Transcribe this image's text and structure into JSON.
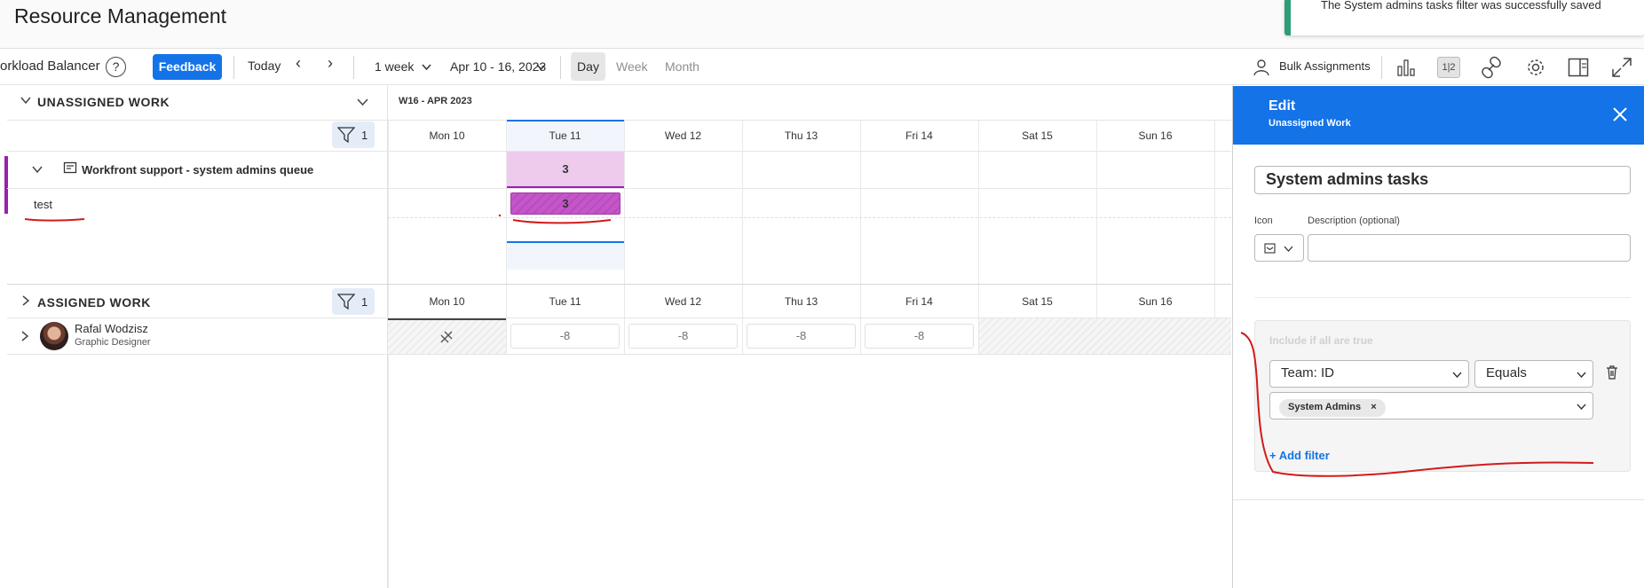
{
  "header": {
    "title": "Resource Management"
  },
  "toast": {
    "message": "The System admins tasks filter was successfully saved"
  },
  "toolbar": {
    "app_name": "orkload Balancer",
    "help_icon": "?",
    "feedback_label": "Feedback",
    "today_label": "Today",
    "range_label": "1 week",
    "date_range": "Apr 10 - 16, 2023",
    "views": {
      "day": "Day",
      "week": "Week",
      "month": "Month"
    },
    "bulk_label": "Bulk Assignments",
    "active_icon_text": "1|2"
  },
  "unassigned": {
    "title": "UNASSIGNED WORK",
    "filter_count": "1",
    "queue_name": "Workfront support - system admins queue",
    "task_name": "test",
    "queue_total": "3",
    "task_total": "3"
  },
  "calendar": {
    "week_label": "W16 - APR 2023",
    "days": [
      "Mon 10",
      "Tue 11",
      "Wed 12",
      "Thu 13",
      "Fri 14",
      "Sat 15",
      "Sun 16"
    ]
  },
  "assigned": {
    "title": "ASSIGNED WORK",
    "filter_count": "1",
    "users": [
      {
        "name": "Rafal Wodzisz",
        "role": "Graphic Designer",
        "hours": [
          "-8",
          "-8",
          "-8",
          "-8"
        ]
      }
    ]
  },
  "edit_panel": {
    "title": "Edit",
    "subtitle": "Unassigned Work",
    "name_value": "System admins tasks",
    "icon_label": "Icon",
    "description_label": "Description (optional)",
    "description_value": "",
    "include_label": "Include if all are true",
    "field_select": "Team: ID",
    "operator_select": "Equals",
    "tag": "System Admins",
    "tag_remove": "×",
    "add_filter": "+ Add filter"
  },
  "colors": {
    "accent": "#1473e6",
    "queue_marker": "#9b1fae",
    "queue_cell": "#eecbed",
    "task_bar": "#c456c9",
    "annotation": "#d11b1b",
    "toast_success": "#2d9d78"
  }
}
